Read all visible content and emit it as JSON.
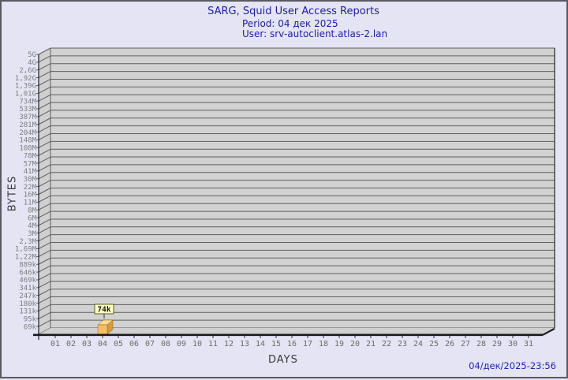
{
  "header": {
    "title": "SARG, Squid User Access Reports",
    "period_line": "Period: 04 дек 2025",
    "user_line": "User: srv-autoclient.atlas-2.lan"
  },
  "footer": {
    "generated": "04/дек/2025-23:56"
  },
  "chart_data": {
    "type": "bar",
    "title": "SARG, Squid User Access Reports",
    "xlabel": "DAYS",
    "ylabel": "BYTES",
    "y_scale": "log",
    "grid": true,
    "style": "3d-bar",
    "y_tick_labels": [
      "5G",
      "4G",
      "2,6G",
      "1,92G",
      "1,39G",
      "1,01G",
      "734M",
      "533M",
      "387M",
      "281M",
      "204M",
      "148M",
      "108M",
      "78M",
      "57M",
      "41M",
      "30M",
      "22M",
      "16M",
      "11M",
      "8M",
      "6M",
      "4M",
      "3M",
      "2,3M",
      "1,69M",
      "1,22M",
      "889k",
      "646k",
      "469k",
      "341k",
      "247k",
      "180k",
      "131k",
      "95k",
      "69k"
    ],
    "categories": [
      "01",
      "02",
      "03",
      "04",
      "05",
      "06",
      "07",
      "08",
      "09",
      "10",
      "11",
      "12",
      "13",
      "14",
      "15",
      "16",
      "17",
      "18",
      "19",
      "20",
      "21",
      "22",
      "23",
      "24",
      "25",
      "26",
      "27",
      "28",
      "29",
      "30",
      "31"
    ],
    "values": [
      0,
      0,
      0,
      74000,
      0,
      0,
      0,
      0,
      0,
      0,
      0,
      0,
      0,
      0,
      0,
      0,
      0,
      0,
      0,
      0,
      0,
      0,
      0,
      0,
      0,
      0,
      0,
      0,
      0,
      0,
      0
    ],
    "bar_value_labels": [
      "",
      "",
      "",
      "74k",
      "",
      "",
      "",
      "",
      "",
      "",
      "",
      "",
      "",
      "",
      "",
      "",
      "",
      "",
      "",
      "",
      "",
      "",
      "",
      "",
      "",
      "",
      "",
      "",
      "",
      "",
      ""
    ]
  },
  "colors": {
    "background": "#e4e4f4",
    "title_text": "#1e1e9e",
    "plot_band": "#d2d2d2",
    "wall_fill": "#d0d0d0",
    "grid_line": "#5f5f5f",
    "axis_dark": "#1a1a1a",
    "y_tick_text": "#7d7d7d",
    "x_tick_text": "#6a6a6a",
    "bar_front": "#f6be63",
    "bar_top": "#fbdc96",
    "bar_side": "#d89b3c",
    "bar_edge": "#8a6420",
    "annotation_bg": "#ffffc8",
    "annotation_border": "#5a5a20",
    "annotation_text": "#1a1a1a"
  }
}
